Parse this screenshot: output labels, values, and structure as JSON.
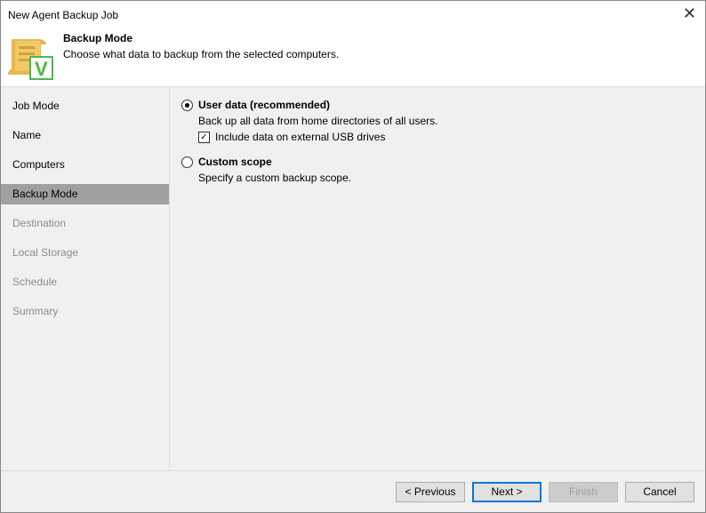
{
  "window": {
    "title": "New Agent Backup Job",
    "close_icon": "close-icon"
  },
  "header": {
    "title": "Backup Mode",
    "subtitle": "Choose what data to backup from the selected computers."
  },
  "sidebar": {
    "items": [
      {
        "label": "Job Mode",
        "state": "done"
      },
      {
        "label": "Name",
        "state": "done"
      },
      {
        "label": "Computers",
        "state": "done"
      },
      {
        "label": "Backup Mode",
        "state": "active"
      },
      {
        "label": "Destination",
        "state": "disabled"
      },
      {
        "label": "Local Storage",
        "state": "disabled"
      },
      {
        "label": "Schedule",
        "state": "disabled"
      },
      {
        "label": "Summary",
        "state": "disabled"
      }
    ]
  },
  "options": {
    "user_data": {
      "label": "User data (recommended)",
      "description": "Back up all data from home directories of all users.",
      "selected": true,
      "usb": {
        "label": "Include data on external USB drives",
        "checked": true
      }
    },
    "custom": {
      "label": "Custom scope",
      "description": "Specify a custom backup scope.",
      "selected": false
    }
  },
  "buttons": {
    "previous": "< Previous",
    "next": "Next >",
    "finish": "Finish",
    "cancel": "Cancel"
  }
}
